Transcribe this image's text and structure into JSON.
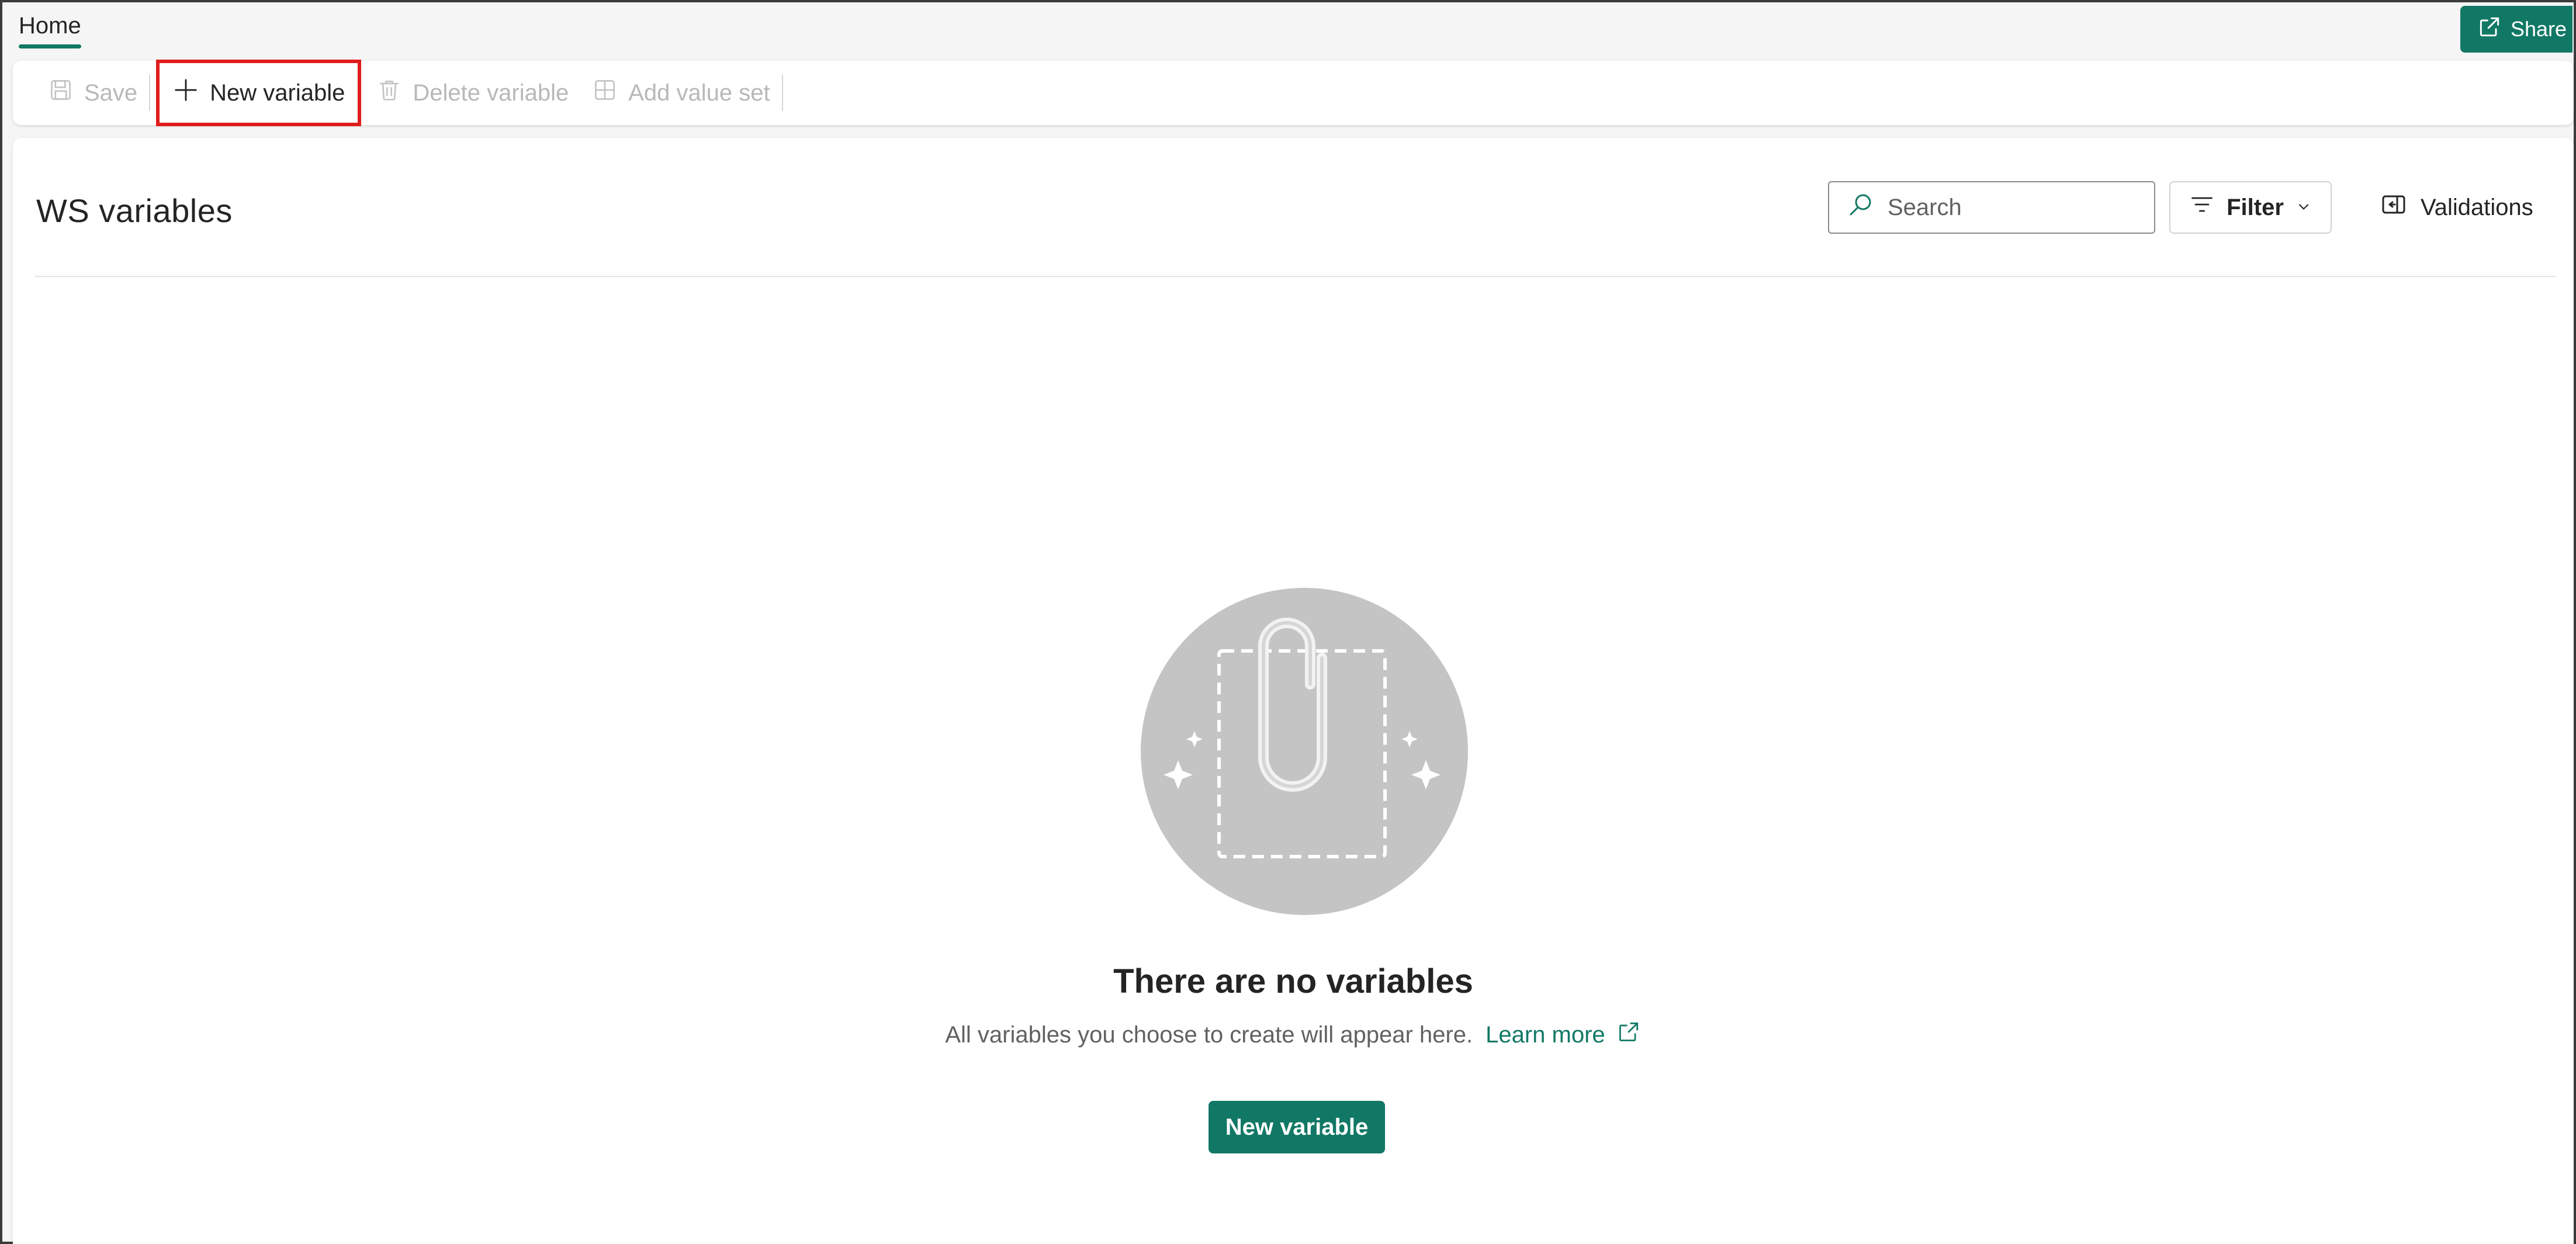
{
  "tabs": {
    "home_label": "Home"
  },
  "share": {
    "label": "Share"
  },
  "toolbar": {
    "save_label": "Save",
    "new_variable_label": "New variable",
    "delete_variable_label": "Delete variable",
    "add_value_set_label": "Add value set"
  },
  "header": {
    "title": "WS variables",
    "search_placeholder": "Search",
    "filter_label": "Filter",
    "validations_label": "Validations"
  },
  "empty_state": {
    "title": "There are no variables",
    "description": "All variables you choose to create will appear here.",
    "learn_more_label": "Learn more",
    "button_label": "New variable"
  },
  "icons": {
    "share": "share-icon",
    "save": "save-icon",
    "new_variable": "plus-icon",
    "delete": "trash-icon",
    "add_value_set": "table-add-icon",
    "search": "search-icon",
    "filter": "filter-icon",
    "validations": "panel-icon",
    "learn_more": "external-link-icon",
    "illustration": "paperclip-illustration"
  },
  "colors": {
    "accent": "#117865",
    "highlight_outline": "#e01c1c",
    "disabled_text": "#b8b8b8"
  }
}
